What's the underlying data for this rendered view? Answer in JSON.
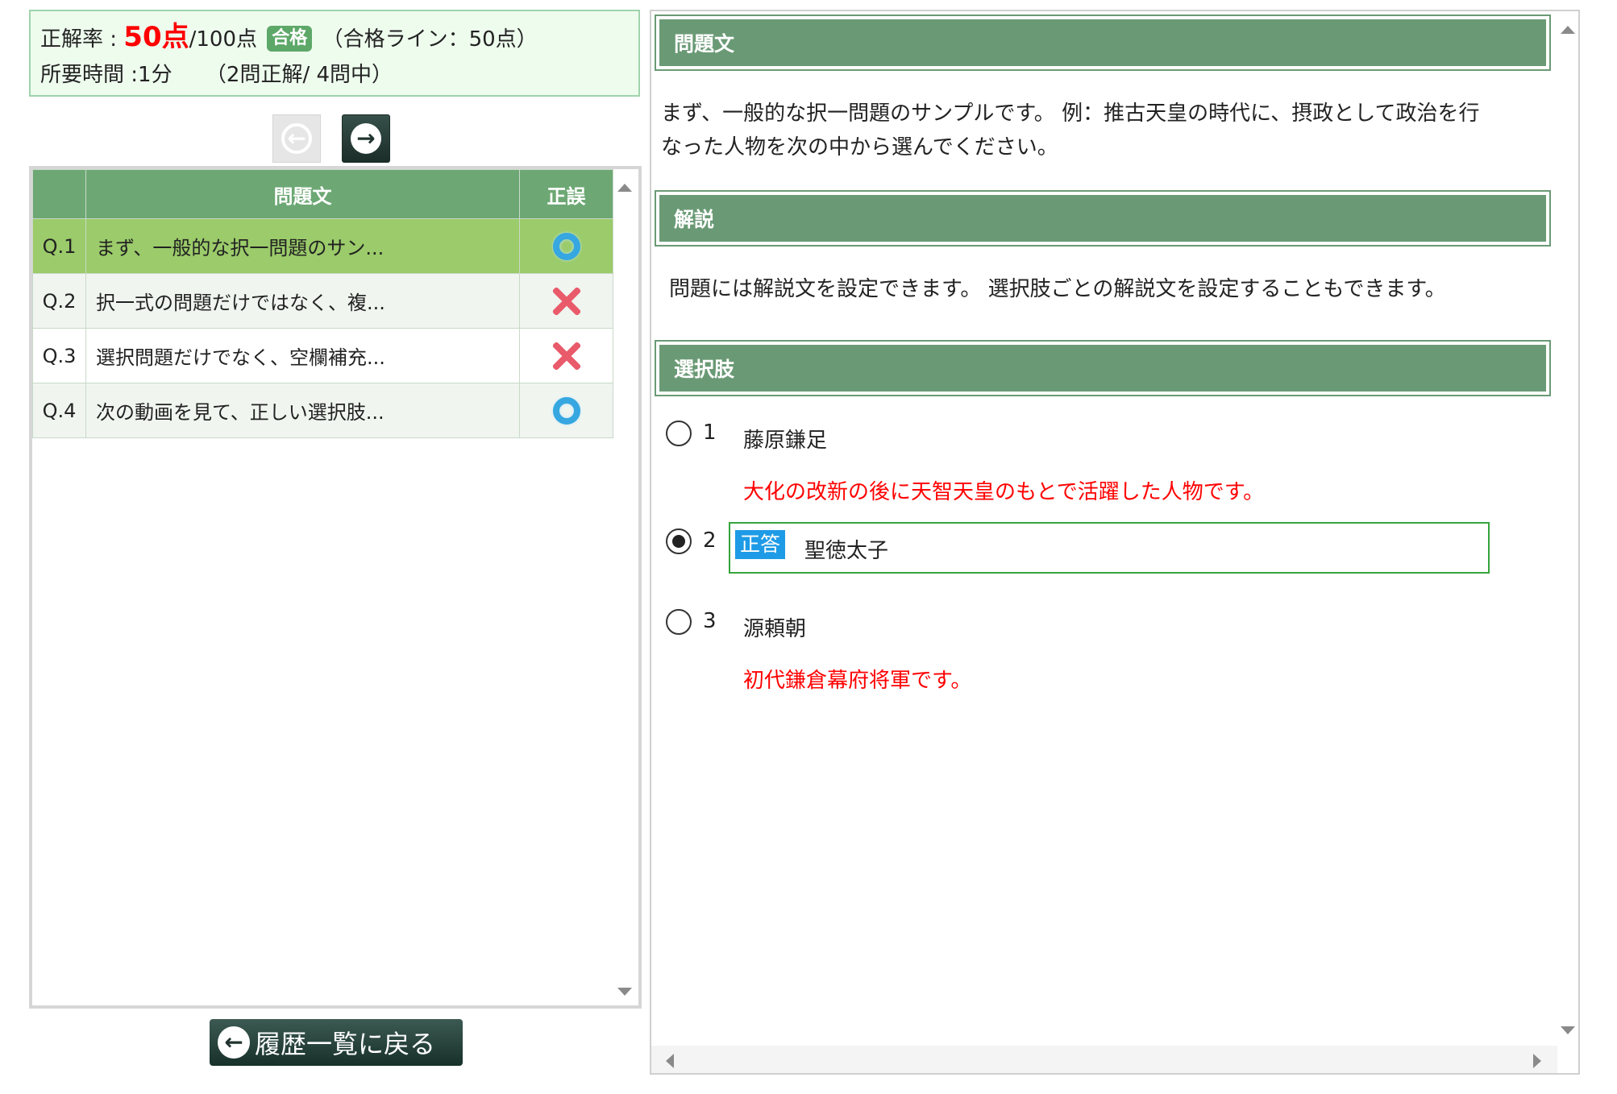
{
  "score": {
    "rate_label": "正解率 :",
    "score_value": "50点",
    "score_total": "/100点",
    "pass_badge": "合格",
    "pass_line": "（合格ライン：50点）",
    "time_label": "所要時間 :1分",
    "correct_count": "（2問正解/ 4問中）"
  },
  "nav": {
    "prev_icon": "arrow-left-icon",
    "next_icon": "arrow-right-icon"
  },
  "question_list": {
    "headers": {
      "no": "",
      "text": "問題文",
      "result": "正誤"
    },
    "rows": [
      {
        "no": "Q.1",
        "text": "まず、一般的な択一問題のサン...",
        "result": "correct"
      },
      {
        "no": "Q.2",
        "text": "択一式の問題だけではなく、複...",
        "result": "incorrect"
      },
      {
        "no": "Q.3",
        "text": "選択問題だけでなく、空欄補充...",
        "result": "incorrect"
      },
      {
        "no": "Q.4",
        "text": "次の動画を見て、正しい選択肢...",
        "result": "correct"
      }
    ]
  },
  "back_button": {
    "label": "履歴一覧に戻る"
  },
  "detail": {
    "question_heading": "問題文",
    "question_line1": "まず、一般的な択一問題のサンプルです。 例：推古天皇の時代に、摂政として政治を行",
    "question_line2": "なった人物を次の中から選んでください。",
    "explanation_heading": "解説",
    "explanation_text": "問題には解説文を設定できます。 選択肢ごとの解説文を設定することもできます。",
    "choices_heading": "選択肢",
    "choices": [
      {
        "no": "1",
        "text": "藤原鎌足",
        "explanation": "大化の改新の後に天智天皇のもとで活躍した人物です。",
        "selected": false,
        "correct": false
      },
      {
        "no": "2",
        "text": "聖徳太子",
        "explanation": "",
        "selected": true,
        "correct": true,
        "correct_badge": "正答"
      },
      {
        "no": "3",
        "text": "源頼朝",
        "explanation": "初代鎌倉幕府将軍です。",
        "selected": false,
        "correct": false
      }
    ]
  },
  "colors": {
    "header_green": "#6a9a75",
    "table_header_green": "#6da874",
    "selected_row": "#9bcb6a",
    "explanation_red": "#ff0000",
    "correct_blue": "#1e9be6"
  }
}
